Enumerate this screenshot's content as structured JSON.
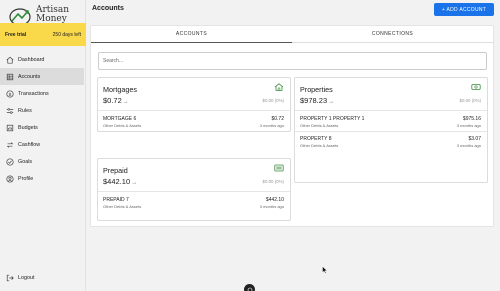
{
  "app": {
    "logo_line1": "Artisan",
    "logo_line2": "Money"
  },
  "trial": {
    "label": "Free trial",
    "days_left": "250 days left"
  },
  "sidebar": {
    "items": [
      {
        "label": "Dashboard",
        "icon": "home-icon"
      },
      {
        "label": "Accounts",
        "icon": "accounts-icon",
        "active": true
      },
      {
        "label": "Transactions",
        "icon": "dollar-icon"
      },
      {
        "label": "Rules",
        "icon": "rules-icon"
      },
      {
        "label": "Budgets",
        "icon": "budget-icon"
      },
      {
        "label": "Cashflow",
        "icon": "cashflow-icon"
      },
      {
        "label": "Goals",
        "icon": "goals-icon"
      },
      {
        "label": "Profile",
        "icon": "profile-icon"
      }
    ],
    "logout": "Logout"
  },
  "header": {
    "title": "Accounts",
    "add_button": "+ ADD ACCOUNT"
  },
  "tabs": [
    {
      "label": "ACCOUNTS",
      "active": true
    },
    {
      "label": "CONNECTIONS",
      "active": false
    }
  ],
  "search": {
    "placeholder": "Search..."
  },
  "cards": {
    "mortgages": {
      "title": "Mortgages",
      "total": "$0.72",
      "change": "$0.00 (0%)",
      "icon": "house-icon",
      "accounts": [
        {
          "name": "MORTGAGE 6",
          "type": "Other Debts & Assets",
          "amount": "$0.72",
          "time": "3 months ago"
        }
      ]
    },
    "properties": {
      "title": "Properties",
      "total": "$978.23",
      "change": "$0.00 (0%)",
      "icon": "cash-icon",
      "accounts": [
        {
          "name": "PROPERTY 1 PROPERTY 1",
          "type": "Other Debts & Assets",
          "amount": "$975.16",
          "time": "3 months ago"
        },
        {
          "name": "PROPERTY 8",
          "type": "Other Debts & Assets",
          "amount": "$3.07",
          "time": "3 months ago"
        }
      ]
    },
    "prepaid": {
      "title": "Prepaid",
      "total": "$442.10",
      "change": "$0.00 (0%)",
      "icon": "card-icon",
      "accounts": [
        {
          "name": "PREPAID 7",
          "type": "Other Debts & Assets",
          "amount": "$442.10",
          "time": "3 months ago"
        }
      ]
    }
  },
  "arrow_glyph": "→",
  "colors": {
    "accent": "#1a73e8",
    "trial_banner": "#f9d84a",
    "active_nav": "#dcdcdc",
    "icon_green": "#3a8a3a"
  }
}
